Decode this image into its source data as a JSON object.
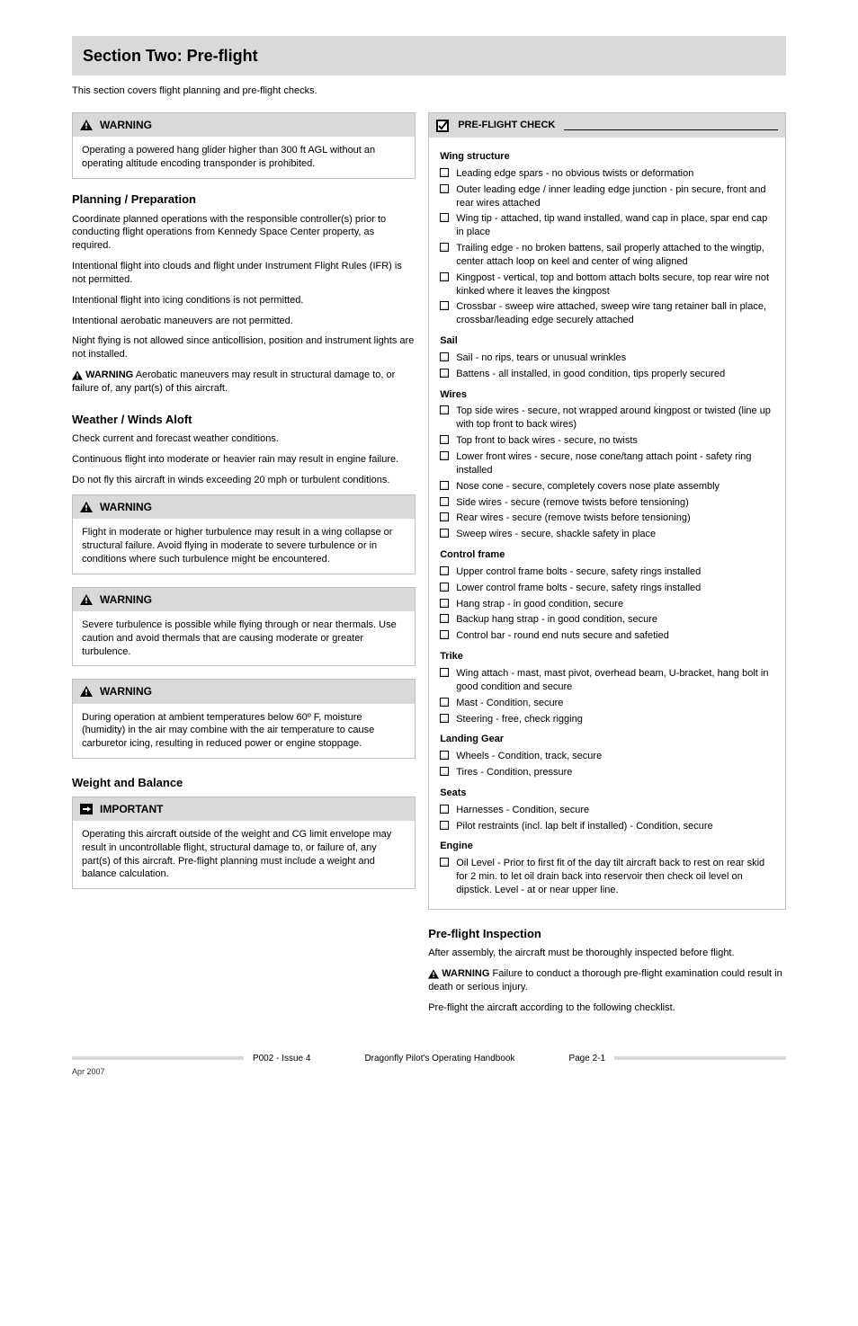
{
  "title": "Section Two: Pre-flight",
  "intro": "This section covers flight planning and pre-flight checks.",
  "left": {
    "warningBox": {
      "label": "WARNING",
      "body": "Operating a powered hang glider higher than 300 ft AGL without an operating altitude encoding transponder is prohibited."
    },
    "planningHead": "Planning / Preparation",
    "planningParas": [
      "Coordinate planned operations with the responsible controller(s) prior to conducting flight operations from Kennedy Space Center property, as required.",
      "Intentional flight into clouds and flight under Instrument Flight Rules (IFR) is not permitted.",
      "Intentional flight into icing conditions is not permitted.",
      "Intentional aerobatic maneuvers are not permitted.",
      "Night flying is not allowed since anticollision, position and instrument lights are not installed."
    ],
    "planningWarnLabel": "WARNING",
    "planningWarnBody": "Aerobatic maneuvers may result in structural damage to, or failure of, any part(s) of this aircraft.",
    "weatherHead": "Weather / Winds Aloft",
    "weatherParas": [
      "Check current and forecast weather conditions.",
      "Continuous flight into moderate or heavier rain may result in engine failure.",
      "Do not fly this aircraft in winds exceeding 20 mph or turbulent conditions."
    ],
    "turbBox": {
      "label": "WARNING",
      "body": "Flight in moderate or higher turbulence may result in a wing collapse or structural failure. Avoid flying in moderate to severe turbulence or in conditions where such turbulence might be encountered."
    },
    "thermBox": {
      "label": "WARNING",
      "body": "Severe turbulence is possible while flying through or near thermals. Use caution and avoid thermals that are causing moderate or greater turbulence."
    },
    "tempBox": {
      "label": "WARNING",
      "body": "During operation at ambient temperatures below 60º F, moisture (humidity) in the air may combine with the air temperature to cause carburetor icing, resulting in reduced power or engine stoppage."
    },
    "weightHead": "Weight and Balance",
    "weightBox": {
      "label": "IMPORTANT",
      "body": "Operating this aircraft outside of the weight and CG limit envelope may result in uncontrollable flight, structural damage to, or failure of, any part(s) of this aircraft. Pre-flight planning must include a weight and balance calculation."
    }
  },
  "right": {
    "checklistTitle": "PRE-FLIGHT CHECK",
    "groups": [
      {
        "label": "Wing structure",
        "items": [
          "Leading edge spars - no obvious twists or deformation",
          "Outer leading edge / inner leading edge junction - pin secure, front and rear wires attached",
          "Wing tip - attached, tip wand installed, wand cap in place, spar end cap in place",
          "Trailing edge - no broken battens, sail properly attached to the wingtip, center attach loop on keel and center of wing aligned",
          "Kingpost - vertical, top and bottom attach bolts secure, top rear wire not kinked where it leaves the kingpost",
          "Crossbar - sweep wire attached, sweep wire tang retainer ball in place, crossbar/leading edge securely attached"
        ]
      },
      {
        "label": "Sail",
        "items": [
          "Sail - no rips, tears or unusual wrinkles",
          "Battens - all installed, in good condition, tips properly secured"
        ]
      },
      {
        "label": "Wires",
        "items": [
          "Top side wires - secure, not wrapped around kingpost or twisted (line up with top front to back wires)",
          "Top front to back wires - secure, no twists",
          "Lower front wires - secure, nose cone/tang attach point - safety ring installed",
          "Nose cone - secure, completely covers nose plate assembly",
          "Side wires - secure (remove twists before tensioning)",
          "Rear wires - secure (remove twists before tensioning)",
          "Sweep wires - secure, shackle safety in place"
        ]
      },
      {
        "label": "Control frame",
        "items": [
          "Upper control frame bolts - secure, safety rings installed",
          "Lower control frame bolts - secure, safety rings installed",
          "Hang strap - in good condition, secure",
          "Backup hang strap - in good condition, secure",
          "Control bar - round end nuts secure and safetied"
        ]
      },
      {
        "label": "Trike",
        "items": [
          "Wing attach - mast, mast pivot, overhead beam, U-bracket, hang bolt in good condition and secure",
          "Mast - Condition, secure",
          "Steering - free, check rigging"
        ]
      },
      {
        "label": "Landing Gear",
        "items": [
          "Wheels - Condition, track, secure",
          "Tires - Condition, pressure"
        ]
      },
      {
        "label": "Seats",
        "items": [
          "Harnesses - Condition, secure",
          "Pilot restraints (incl. lap belt if installed) - Condition, secure"
        ]
      },
      {
        "label": "Engine",
        "items": [
          "Oil Level - Prior to first fit of the day tilt aircraft back to rest on rear skid for 2 min. to let oil drain back into reservoir then check oil level on dipstick. Level - at or near upper line."
        ]
      }
    ],
    "afterTitle": "Pre-flight Inspection",
    "afterPara1": "After assembly, the aircraft must be thoroughly inspected before flight.",
    "afterWarnLabel": "WARNING",
    "afterPara2": "Failure to conduct a thorough pre-flight examination could result in death or serious injury.",
    "afterPara3": "Pre-flight the aircraft according to the following checklist."
  },
  "footer": {
    "left": "P002 - Issue 4",
    "center": "Dragonfly Pilot's Operating Handbook",
    "right": "Page 2-1",
    "sub": "Apr 2007"
  }
}
